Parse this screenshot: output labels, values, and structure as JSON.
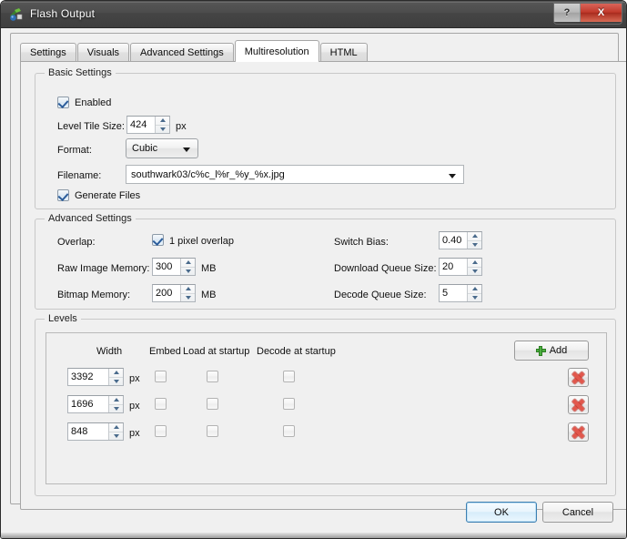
{
  "window": {
    "title": "Flash Output",
    "icon": "flash-app-icon",
    "caption_buttons": [
      {
        "name": "help-button",
        "label": "?"
      },
      {
        "name": "close-button",
        "label": "X"
      }
    ]
  },
  "tabs": [
    {
      "label": "Settings",
      "active": false
    },
    {
      "label": "Visuals",
      "active": false
    },
    {
      "label": "Advanced Settings",
      "active": false
    },
    {
      "label": "Multiresolution",
      "active": true
    },
    {
      "label": "HTML",
      "active": false
    }
  ],
  "basic_settings": {
    "title": "Basic Settings",
    "enabled": {
      "label": "Enabled",
      "checked": true
    },
    "level_tile_size": {
      "label": "Level Tile Size:",
      "value": "424",
      "unit": "px"
    },
    "format": {
      "label": "Format:",
      "value": "Cubic"
    },
    "filename": {
      "label": "Filename:",
      "value": "southwark03/c%c_l%r_%y_%x.jpg"
    },
    "generate_files": {
      "label": "Generate Files",
      "checked": true
    }
  },
  "advanced_settings": {
    "title": "Advanced Settings",
    "overlap": {
      "label": "Overlap:",
      "checkbox_label": "1 pixel overlap",
      "checked": true
    },
    "raw_image_memory": {
      "label": "Raw Image Memory:",
      "value": "300",
      "unit": "MB"
    },
    "bitmap_memory": {
      "label": "Bitmap Memory:",
      "value": "200",
      "unit": "MB"
    },
    "switch_bias": {
      "label": "Switch Bias:",
      "value": "0.40"
    },
    "download_queue_size": {
      "label": "Download Queue Size:",
      "value": "20"
    },
    "decode_queue_size": {
      "label": "Decode Queue Size:",
      "value": "5"
    }
  },
  "levels": {
    "title": "Levels",
    "add_button": "Add",
    "headers": {
      "width": "Width",
      "embed": "Embed",
      "load_at_startup": "Load at startup",
      "decode_at_startup": "Decode at startup"
    },
    "unit": "px",
    "rows": [
      {
        "width": "3392",
        "embed": false,
        "load_at_startup": false,
        "decode_at_startup": false
      },
      {
        "width": "1696",
        "embed": false,
        "load_at_startup": false,
        "decode_at_startup": false
      },
      {
        "width": "848",
        "embed": false,
        "load_at_startup": false,
        "decode_at_startup": false
      }
    ]
  },
  "footer": {
    "ok": "OK",
    "cancel": "Cancel"
  },
  "colors": {
    "titlebar": "#4a4a4a",
    "dialog_bg": "#f0f0f0",
    "accent_blue": "#3c7fb1",
    "close_red": "#c0392b",
    "add_green": "#4caf3f",
    "delete_red": "#e2574c"
  }
}
